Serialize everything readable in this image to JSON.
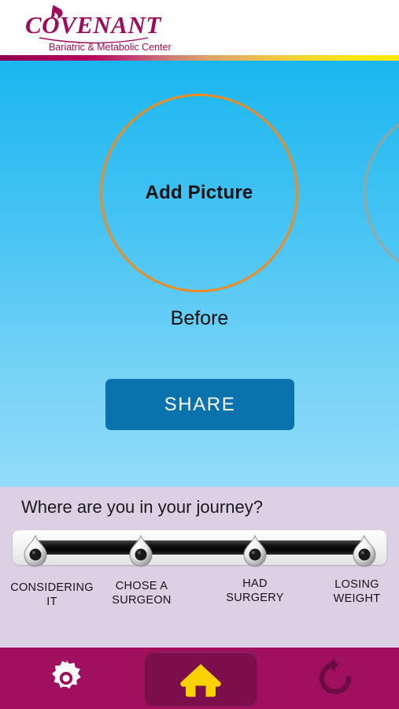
{
  "app": {
    "title": "Covenant Bariatric & Metabolic Center"
  },
  "header": {
    "logo_name": "COVENANT",
    "logo_tagline": "Bariatric & Metabolic Center",
    "logo_mark": "flame-icon",
    "brand_color": "#9e0a5c",
    "gradient_colors": [
      "#8e0050",
      "#b4005f",
      "#dba26a",
      "#ffe800"
    ]
  },
  "photo": {
    "add_picture_label": "Add Picture",
    "before_label": "Before",
    "circle_border_color": "#ef8b1f",
    "next_circle_border_color": "#aaa08c",
    "background_top_color": "#1ab6f0",
    "background_bottom_color": "#92dbf9",
    "share_label": "SHARE",
    "share_color": "#0a72ad"
  },
  "journey": {
    "title": "Where are you in your journey?",
    "panel_color": "#dcd0e4",
    "track_color": "#0a0a0a",
    "steps": [
      {
        "label_line1": "CONSIDERING",
        "label_line2": "IT",
        "icon": "pin-marker-icon"
      },
      {
        "label_line1": "CHOSE A",
        "label_line2": "SURGEON",
        "icon": "pin-marker-icon"
      },
      {
        "label_line1": "HAD",
        "label_line2": "SURGERY",
        "icon": "pin-marker-icon"
      },
      {
        "label_line1": "LOSING",
        "label_line2": "WEIGHT",
        "icon": "pin-marker-icon"
      }
    ]
  },
  "navbar": {
    "background_color": "#a0105f",
    "active_background_color": "#7c0e4c",
    "items": [
      {
        "name": "settings",
        "icon": "gear-icon",
        "color": "#ffffff",
        "active": false
      },
      {
        "name": "home",
        "icon": "home-icon",
        "color": "#fad200",
        "active": true
      },
      {
        "name": "refresh",
        "icon": "refresh-icon",
        "color": "#6d0b43",
        "active": false
      }
    ]
  }
}
